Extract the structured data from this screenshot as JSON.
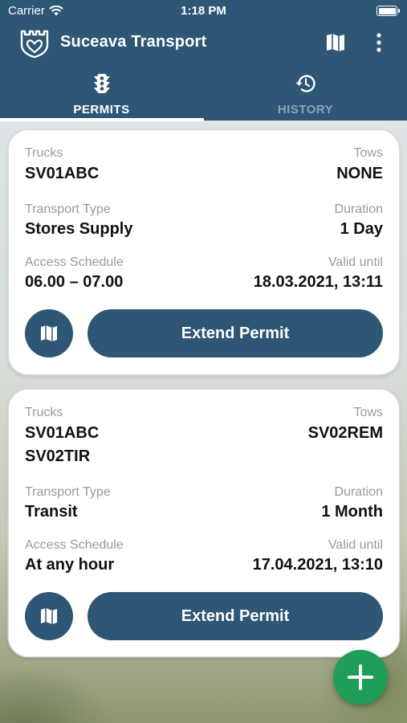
{
  "status_bar": {
    "carrier": "Carrier",
    "time": "1:18 PM"
  },
  "app_bar": {
    "title": "Suceava Transport"
  },
  "tabs": [
    {
      "label": "PERMITS",
      "icon": "traffic-light-icon",
      "active": true
    },
    {
      "label": "HISTORY",
      "icon": "history-icon",
      "active": false
    }
  ],
  "permits": [
    {
      "trucks_label": "Trucks",
      "trucks": [
        "SV01ABC"
      ],
      "tows_label": "Tows",
      "tows": "NONE",
      "transport_type_label": "Transport Type",
      "transport_type": "Stores Supply",
      "duration_label": "Duration",
      "duration": "1 Day",
      "access_schedule_label": "Access Schedule",
      "access_schedule": "06.00 – 07.00",
      "valid_until_label": "Valid until",
      "valid_until": "18.03.2021, 13:11",
      "extend_label": "Extend Permit"
    },
    {
      "trucks_label": "Trucks",
      "trucks": [
        "SV01ABC",
        "SV02TIR"
      ],
      "tows_label": "Tows",
      "tows": "SV02REM",
      "transport_type_label": "Transport Type",
      "transport_type": "Transit",
      "duration_label": "Duration",
      "duration": "1 Month",
      "access_schedule_label": "Access Schedule",
      "access_schedule": "At any hour",
      "valid_until_label": "Valid until",
      "valid_until": "17.04.2021, 13:10",
      "extend_label": "Extend Permit"
    }
  ],
  "colors": {
    "primary": "#2e5675",
    "fab": "#1e9e57",
    "inactive_tab": "#8aa4b9"
  }
}
